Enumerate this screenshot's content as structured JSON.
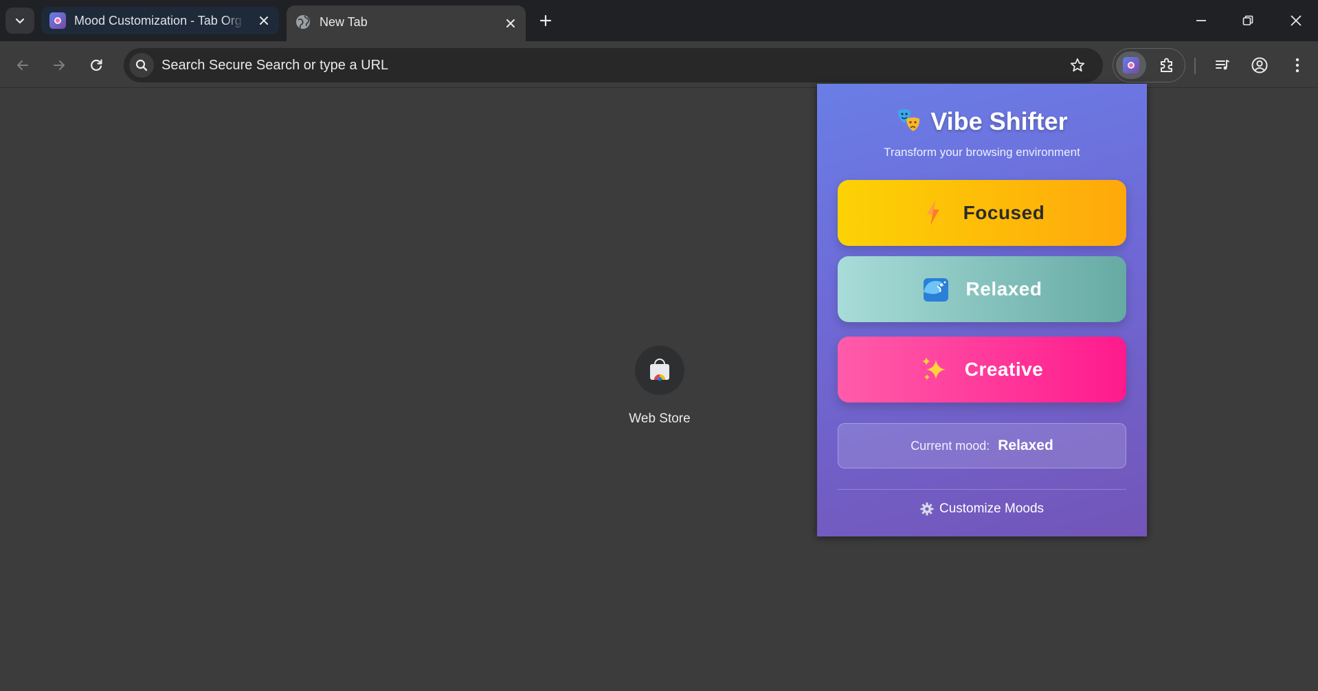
{
  "browser": {
    "tabs": [
      {
        "title": "Mood Customization - Tab Org",
        "active": false
      },
      {
        "title": "New Tab",
        "active": true
      }
    ],
    "omnibox": {
      "placeholder": "Search Secure Search or type a URL"
    },
    "icons": {
      "tab_search": "chevron-down-icon",
      "new_tab": "plus-icon",
      "back": "arrow-left-icon",
      "forward": "arrow-right-icon",
      "reload": "reload-icon",
      "bookmark": "star-icon",
      "extensions": "puzzle-icon",
      "media": "media-control-icon",
      "profile": "account-circle-icon",
      "menu": "kebab-menu-icon"
    }
  },
  "new_tab_page": {
    "shortcuts": [
      {
        "label": "Web Store",
        "icon": "web-store-icon"
      }
    ]
  },
  "popup": {
    "title": "Vibe Shifter",
    "subtitle": "Transform your browsing environment",
    "moods": [
      {
        "label": "Focused",
        "icon": "lightning-icon",
        "colors": [
          "#fcd205",
          "#ffa80b"
        ]
      },
      {
        "label": "Relaxed",
        "icon": "wave-icon",
        "colors": [
          "#a8dcd8",
          "#66aaa4"
        ]
      },
      {
        "label": "Creative",
        "icon": "sparkles-icon",
        "colors": [
          "#ff5caa",
          "#ff1a8c"
        ]
      }
    ],
    "status": {
      "label": "Current mood:",
      "value": "Relaxed"
    },
    "customize_label": "Customize Moods",
    "accent_gradient": [
      "#6a7ee6",
      "#7355b8"
    ]
  }
}
